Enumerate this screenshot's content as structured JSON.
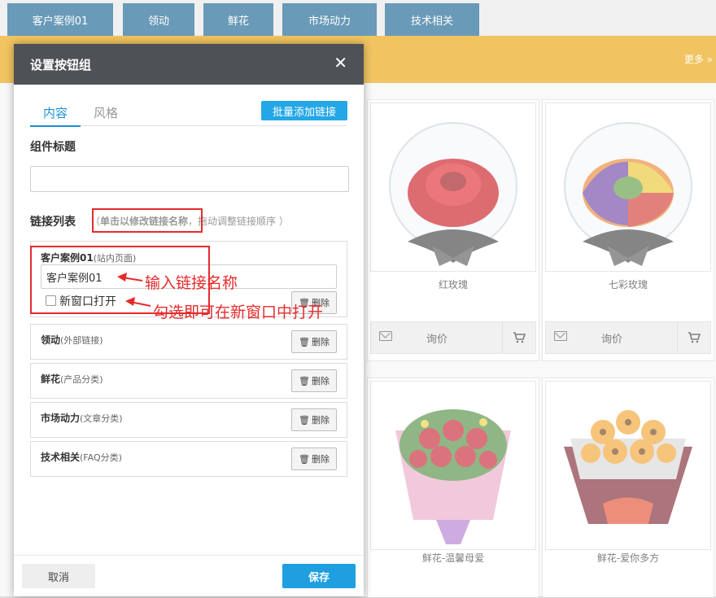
{
  "topnav": {
    "tabs": [
      "客户案例01",
      "领动",
      "鲜花",
      "市场动力",
      "技术相关"
    ]
  },
  "orange_bar": {
    "more_label": "更多 »"
  },
  "products": [
    {
      "name": "红玫瑰",
      "inquiry_label": "询价"
    },
    {
      "name": "七彩玫瑰",
      "inquiry_label": "询价"
    },
    {
      "name": "鲜花-温馨母爱"
    },
    {
      "name": "鲜花-爱你多方"
    }
  ],
  "dialog": {
    "title": "设置按钮组",
    "close_glyph": "✕",
    "tabs": [
      "内容",
      "风格"
    ],
    "batch_add_label": "批量添加链接",
    "component_title_label": "组件标题",
    "component_title_value": "",
    "link_list_label": "链接列表",
    "link_list_hint_open": "（",
    "link_list_hint_highlight": "单击以修改链接名称",
    "link_list_hint_rest": "，拖动调整链接顺序 ）",
    "links": [
      {
        "name": "客户案例01",
        "type": "(站内页面)",
        "input_value": "客户案例01",
        "new_window_label": "新窗口打开",
        "new_window_checked": false,
        "delete_label": "删除"
      },
      {
        "name": "领动",
        "type": "(外部链接)",
        "delete_label": "删除"
      },
      {
        "name": "鲜花",
        "type": "(产品分类)",
        "delete_label": "删除"
      },
      {
        "name": "市场动力",
        "type": "(文章分类)",
        "delete_label": "删除"
      },
      {
        "name": "技术相关",
        "type": "(FAQ分类)",
        "delete_label": "删除"
      }
    ],
    "cancel_label": "取消",
    "save_label": "保存"
  },
  "annotations": {
    "enter_link_name": "输入链接名称",
    "check_new_window": "勾选即可在新窗口中打开"
  },
  "colors": {
    "nav_tab": "#0e5c8c",
    "orange_bar": "#e9a000",
    "dialog_header": "#4e5257",
    "primary_button": "#1f9ee0",
    "annotation_red": "#e52b2b"
  }
}
